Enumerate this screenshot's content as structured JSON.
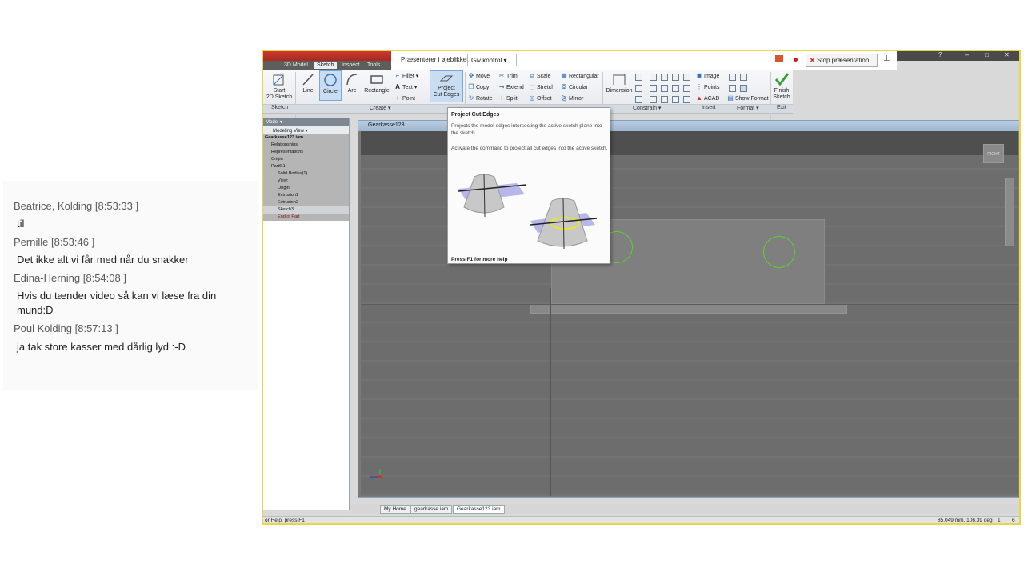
{
  "chat": {
    "messages": [
      {
        "author": "Beatrice, Kolding",
        "time": "[8:53:33 ]",
        "text": "til"
      },
      {
        "author": "Pernille",
        "time": "[8:53:46 ]",
        "text": "Det ikke alt vi får med når du snakker"
      },
      {
        "author": "Edina-Herning",
        "time": "[8:54:08 ]",
        "text": "Hvis du tænder video så kan vi læse fra din mund:D"
      },
      {
        "author": "Poul Kolding",
        "time": "[8:57:13 ]",
        "text": "ja tak store kasser med dårlig lyd :-D"
      }
    ]
  },
  "presenter": {
    "label": "Præsenterer i øjeblikket",
    "give_control": "Giv kontrol",
    "stop": "Stop præsentation"
  },
  "ribbon": {
    "tabs": [
      "3D Model",
      "Sketch",
      "Inspect",
      "Tools"
    ],
    "active_tab": "Sketch",
    "panels": {
      "sketch": "Sketch",
      "create": "Create ▾",
      "constrain": "Constrain ▾",
      "insert": "Insert",
      "format": "Format ▾",
      "exit": "Exit"
    },
    "buttons": {
      "start": "Start\n2D Sketch",
      "line": "Line",
      "circle": "Circle",
      "arc": "Arc",
      "rectangle": "Rectangle",
      "fillet": "Fillet",
      "text": "Text",
      "point": "Point",
      "project": "Project\nCut Edges",
      "move": "Move",
      "copy": "Copy",
      "rotate": "Rotate",
      "trim": "Trim",
      "extend": "Extend",
      "split": "Split",
      "scale": "Scale",
      "stretch": "Stretch",
      "offset": "Offset",
      "rectangular": "Rectangular",
      "circular": "Circular",
      "mirror": "Mirror",
      "dimension": "Dimension",
      "image": "Image",
      "points": "Points",
      "acad": "ACAD",
      "show_format": "Show Format",
      "finish": "Finish\nSketch"
    }
  },
  "browser": {
    "header": "Model ▾",
    "view": "Modeling View",
    "items": [
      "Gearkasse123.iam",
      "Relationships",
      "Representations",
      "Origin",
      "Part6:1",
      "Solid Bodies(1)",
      "View:",
      "Origin",
      "Extrusion1",
      "Extrusion2",
      "Sketch3",
      "End of Part"
    ]
  },
  "document": {
    "title": "Gearkasse123",
    "tabs": [
      "My Home",
      "gearkasse.iam",
      "Gearkasse123.iam"
    ],
    "viewcube": "RIGHT"
  },
  "tooltip": {
    "title": "Project Cut Edges",
    "desc": "Projects the model edges intersecting the active sketch plane into the sketch.",
    "detail": "Activate the command to project all cut edges into the active sketch.",
    "footer": "Press F1 for more help"
  },
  "status": {
    "left": "or Help, press F1",
    "right": "85.049 mm, 106.39 deg",
    "n1": "1",
    "n2": "6"
  }
}
